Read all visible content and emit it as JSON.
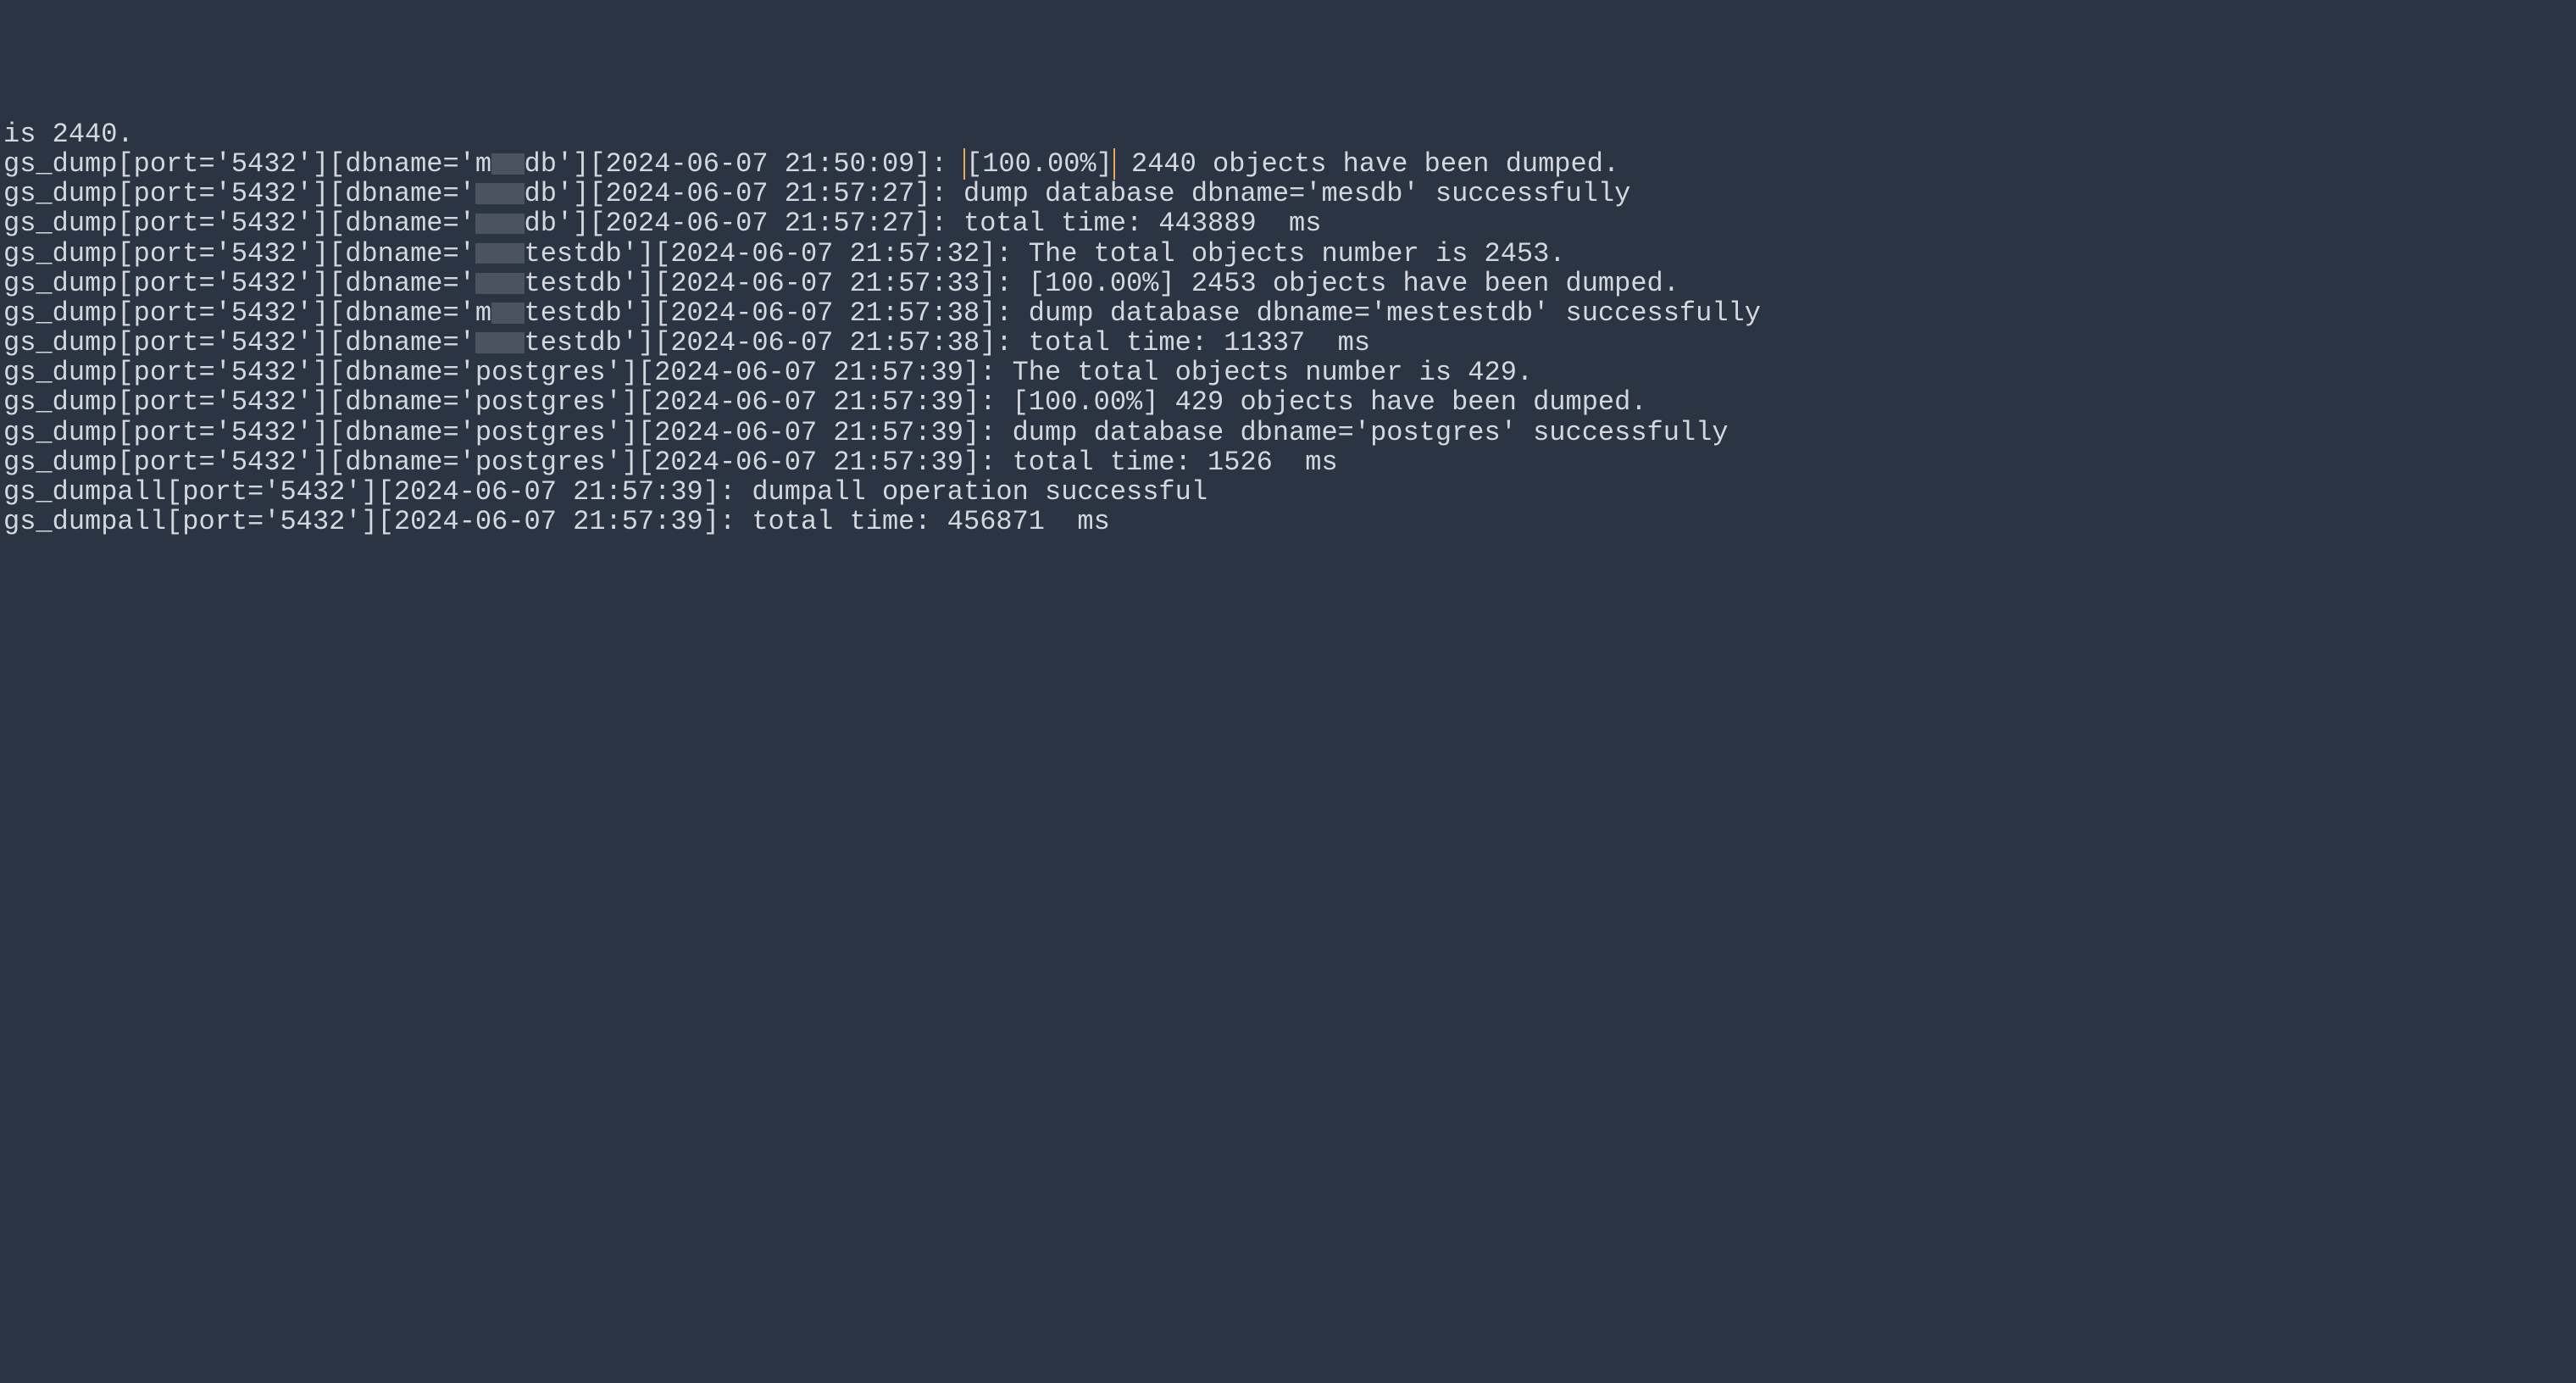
{
  "lines": [
    {
      "type": "plain",
      "segments": [
        {
          "kind": "text",
          "value": "is 2440."
        }
      ]
    },
    {
      "type": "plain",
      "segments": [
        {
          "kind": "text",
          "value": "gs_dump[port='5432'][dbname='m"
        },
        {
          "kind": "redact",
          "value": "es"
        },
        {
          "kind": "text",
          "value": "db'][2024-06-07 21:50:09]: "
        },
        {
          "kind": "cursor",
          "value": "[100.00%]"
        },
        {
          "kind": "text",
          "value": " 2440 objects have been dumped."
        }
      ]
    },
    {
      "type": "plain",
      "segments": [
        {
          "kind": "text",
          "value": "gs_dump[port='5432'][dbname='"
        },
        {
          "kind": "redact",
          "value": "mes"
        },
        {
          "kind": "text",
          "value": "db'][2024-06-07 21:57:27]: dump database dbname='mesdb' successfully"
        }
      ]
    },
    {
      "type": "plain",
      "segments": [
        {
          "kind": "text",
          "value": "gs_dump[port='5432'][dbname='"
        },
        {
          "kind": "redact",
          "value": "mes"
        },
        {
          "kind": "text",
          "value": "db'][2024-06-07 21:57:27]: total time: 443889  ms"
        }
      ]
    },
    {
      "type": "plain",
      "segments": [
        {
          "kind": "text",
          "value": "gs_dump[port='5432'][dbname='"
        },
        {
          "kind": "redact",
          "value": "mes"
        },
        {
          "kind": "text",
          "value": "testdb'][2024-06-07 21:57:32]: The total objects number is 2453."
        }
      ]
    },
    {
      "type": "plain",
      "segments": [
        {
          "kind": "text",
          "value": "gs_dump[port='5432'][dbname='"
        },
        {
          "kind": "redact",
          "value": "mes"
        },
        {
          "kind": "text",
          "value": "testdb'][2024-06-07 21:57:33]: [100.00%] 2453 objects have been dumped."
        }
      ]
    },
    {
      "type": "plain",
      "segments": [
        {
          "kind": "text",
          "value": "gs_dump[port='5432'][dbname='m"
        },
        {
          "kind": "redact",
          "value": "es"
        },
        {
          "kind": "text",
          "value": "testdb'][2024-06-07 21:57:38]: dump database dbname='mestestdb' successfully"
        }
      ]
    },
    {
      "type": "plain",
      "segments": [
        {
          "kind": "text",
          "value": "gs_dump[port='5432'][dbname='"
        },
        {
          "kind": "redact",
          "value": "mes"
        },
        {
          "kind": "text",
          "value": "testdb'][2024-06-07 21:57:38]: total time: 11337  ms"
        }
      ]
    },
    {
      "type": "plain",
      "segments": [
        {
          "kind": "text",
          "value": "gs_dump[port='5432'][dbname='postgres'][2024-06-07 21:57:39]: The total objects number is 429."
        }
      ]
    },
    {
      "type": "plain",
      "segments": [
        {
          "kind": "text",
          "value": "gs_dump[port='5432'][dbname='postgres'][2024-06-07 21:57:39]: [100.00%] 429 objects have been dumped."
        }
      ]
    },
    {
      "type": "plain",
      "segments": [
        {
          "kind": "text",
          "value": "gs_dump[port='5432'][dbname='postgres'][2024-06-07 21:57:39]: dump database dbname='postgres' successfully"
        }
      ]
    },
    {
      "type": "plain",
      "segments": [
        {
          "kind": "text",
          "value": "gs_dump[port='5432'][dbname='postgres'][2024-06-07 21:57:39]: total time: 1526  ms"
        }
      ]
    },
    {
      "type": "plain",
      "segments": [
        {
          "kind": "text",
          "value": "gs_dumpall[port='5432'][2024-06-07 21:57:39]: dumpall operation successful"
        }
      ]
    },
    {
      "type": "plain",
      "segments": [
        {
          "kind": "text",
          "value": "gs_dumpall[port='5432'][2024-06-07 21:57:39]: total time: 456871  ms"
        }
      ]
    }
  ]
}
